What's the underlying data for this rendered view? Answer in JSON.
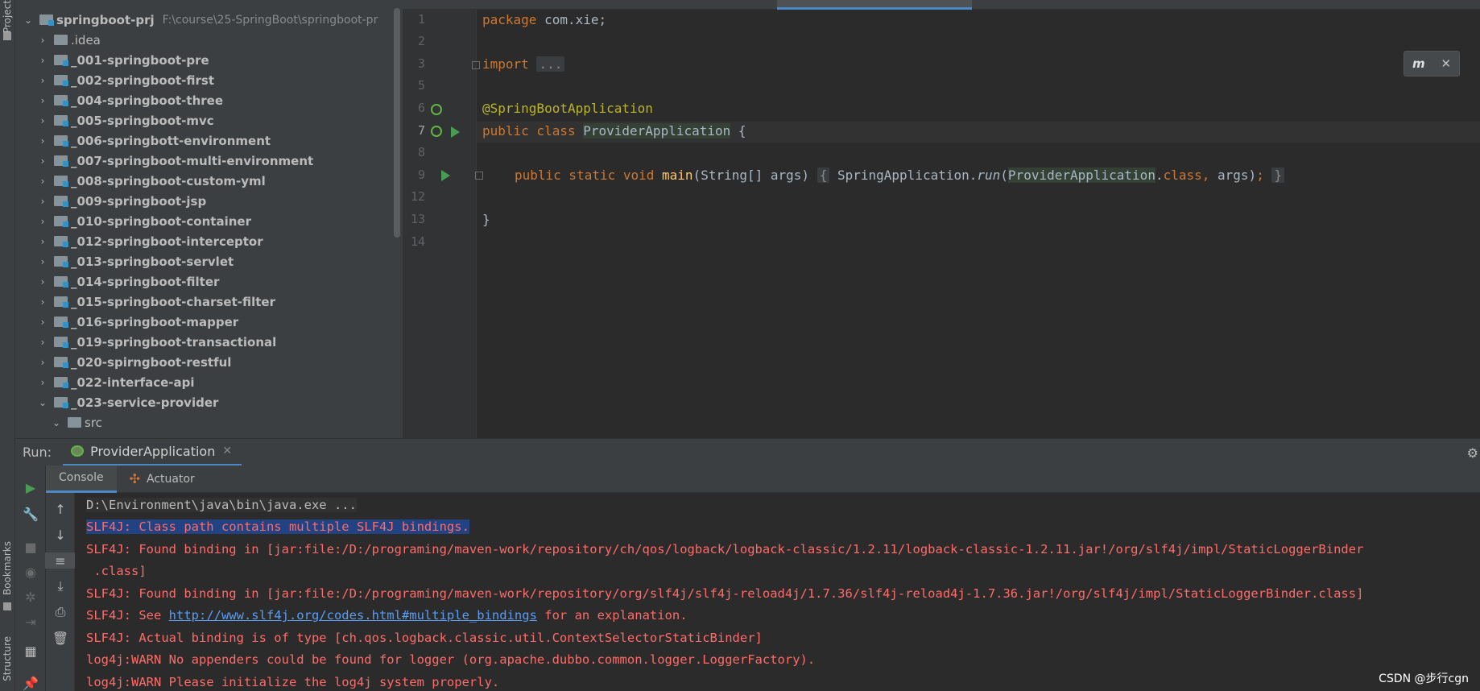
{
  "side_labels": {
    "project": "Project",
    "bookmarks": "Bookmarks",
    "structure": "Structure"
  },
  "project_tree": {
    "root": {
      "name": "springboot-prj",
      "path": "F:\\course\\25-SpringBoot\\springboot-pr"
    },
    "items": [
      {
        "name": ".idea",
        "module": false,
        "expanded": false
      },
      {
        "name": "_001-springboot-pre",
        "module": true,
        "expanded": false
      },
      {
        "name": "_002-springboot-first",
        "module": true,
        "expanded": false
      },
      {
        "name": "_004-springboot-three",
        "module": true,
        "expanded": false
      },
      {
        "name": "_005-springboot-mvc",
        "module": true,
        "expanded": false
      },
      {
        "name": "_006-springbott-environment",
        "module": true,
        "expanded": false
      },
      {
        "name": "_007-springboot-multi-environment",
        "module": true,
        "expanded": false
      },
      {
        "name": "_008-springboot-custom-yml",
        "module": true,
        "expanded": false
      },
      {
        "name": "_009-springboot-jsp",
        "module": true,
        "expanded": false
      },
      {
        "name": "_010-springboot-container",
        "module": true,
        "expanded": false
      },
      {
        "name": "_012-springboot-interceptor",
        "module": true,
        "expanded": false
      },
      {
        "name": "_013-springboot-servlet",
        "module": true,
        "expanded": false
      },
      {
        "name": "_014-springboot-filter",
        "module": true,
        "expanded": false
      },
      {
        "name": "_015-springboot-charset-filter",
        "module": true,
        "expanded": false
      },
      {
        "name": "_016-springboot-mapper",
        "module": true,
        "expanded": false
      },
      {
        "name": "_019-springboot-transactional",
        "module": true,
        "expanded": false
      },
      {
        "name": "_020-spirngboot-restful",
        "module": true,
        "expanded": false
      },
      {
        "name": "_022-interface-api",
        "module": true,
        "expanded": false
      },
      {
        "name": "_023-service-provider",
        "module": true,
        "expanded": true
      },
      {
        "name": "src",
        "module": false,
        "expanded": true
      }
    ]
  },
  "editor": {
    "line_numbers": [
      "1",
      "2",
      "3",
      "5",
      "6",
      "7",
      "8",
      "9",
      "12",
      "13",
      "14"
    ],
    "code": {
      "l1_kw": "package",
      "l1_rest": " com.xie;",
      "l3_kw": "import",
      "l3_fold": "...",
      "l6_ann": "@SpringBootApplication",
      "l7_kw": "public class",
      "l7_cls": "ProviderApplication",
      "l7_rest": " {",
      "l9_kw": "public static void",
      "l9_fn": "main",
      "l9_params": "(String[] args)",
      "l9_open": "{",
      "l9_call": "SpringApplication.",
      "l9_run": "run",
      "l9_paren": "(",
      "l9_cls": "ProviderApplication",
      "l9_dot": ".",
      "l9_classkw": "class,",
      "l9_args": " args)",
      "l9_semi": ";",
      "l9_close": "}",
      "l13": "}"
    }
  },
  "maven_popup": {
    "icon": "maven-reload-icon",
    "close": "✕"
  },
  "run_panel": {
    "label": "Run:",
    "config_tab": "ProviderApplication",
    "close": "✕",
    "tabs": {
      "console": "Console",
      "actuator": "Actuator"
    }
  },
  "console": {
    "cmd": "D:\\Environment\\java\\bin\\java.exe ...",
    "lines": [
      "SLF4J: Class path contains multiple SLF4J bindings.",
      "SLF4J: Found binding in [jar:file:/D:/programing/maven-work/repository/ch/qos/logback/logback-classic/1.2.11/logback-classic-1.2.11.jar!/org/slf4j/impl/StaticLoggerBinder",
      " .class]",
      "SLF4J: Found binding in [jar:file:/D:/programing/maven-work/repository/org/slf4j/slf4j-reload4j/1.7.36/slf4j-reload4j-1.7.36.jar!/org/slf4j/impl/StaticLoggerBinder.class]"
    ],
    "see_prefix": "SLF4J: See ",
    "see_link": "http://www.slf4j.org/codes.html#multiple_bindings",
    "see_suffix": " for an explanation.",
    "lines2": [
      "SLF4J: Actual binding is of type [ch.qos.logback.classic.util.ContextSelectorStaticBinder]",
      "log4j:WARN No appenders could be found for logger (org.apache.dubbo.common.logger.LoggerFactory).",
      "log4j:WARN Please initialize the log4j system properly."
    ]
  },
  "watermark": "CSDN @步行cgn",
  "colors": {
    "background": "#2b2b2b",
    "panel": "#3c3f41",
    "accent": "#4a88c7",
    "error_text": "#ff6b68",
    "keyword": "#cc7832",
    "annotation": "#bbb529"
  }
}
